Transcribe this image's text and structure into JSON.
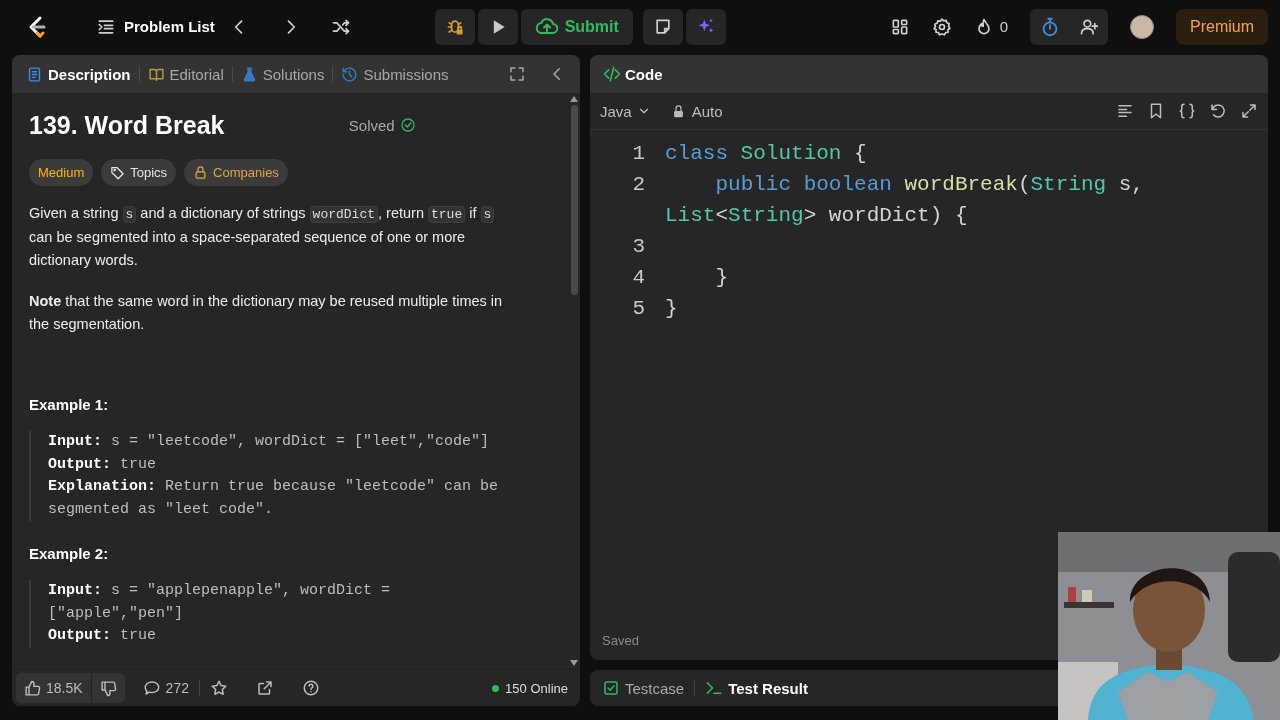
{
  "topbar": {
    "nav_label": "Problem List",
    "submit_label": "Submit",
    "streak_count": "0",
    "premium_label": "Premium"
  },
  "description_panel": {
    "tabs": [
      {
        "label": "Description",
        "kind": "description",
        "selected": true
      },
      {
        "label": "Editorial",
        "kind": "editorial",
        "selected": false
      },
      {
        "label": "Solutions",
        "kind": "solutions",
        "selected": false
      },
      {
        "label": "Submissions",
        "kind": "submissions",
        "selected": false
      }
    ],
    "title": "139. Word Break",
    "status": "Solved",
    "tags": [
      {
        "label": "Medium",
        "kind": "difficulty"
      },
      {
        "label": "Topics",
        "kind": "topics"
      },
      {
        "label": "Companies",
        "kind": "companies"
      }
    ],
    "paragraphs": [
      {
        "segments": [
          {
            "kind": "text",
            "text": "Given a string "
          },
          {
            "kind": "code",
            "text": "s"
          },
          {
            "kind": "text",
            "text": " and a dictionary of strings "
          },
          {
            "kind": "code",
            "text": "wordDict"
          },
          {
            "kind": "text",
            "text": ", return "
          },
          {
            "kind": "code",
            "text": "true"
          },
          {
            "kind": "text",
            "text": " if "
          },
          {
            "kind": "code",
            "text": "s"
          },
          {
            "kind": "text",
            "text": " can be segmented into a space-separated sequence of one or more dictionary words."
          }
        ]
      },
      {
        "segments": [
          {
            "kind": "text",
            "text": "**Note** that the same word in the dictionary may be reused multiple times in the segmentation."
          }
        ]
      }
    ],
    "examples": [
      {
        "title": "Example 1:",
        "lines": [
          {
            "label": "Input:",
            "value": "s = \"leetcode\", wordDict = [\"leet\",\"code\"]"
          },
          {
            "label": "Output:",
            "value": "true"
          },
          {
            "label": "Explanation:",
            "value": "Return true because \"leetcode\" can be segmented as \"leet code\"."
          }
        ]
      },
      {
        "title": "Example 2:",
        "lines": [
          {
            "label": "Input:",
            "value": "s = \"applepenapple\", wordDict = [\"apple\",\"pen\"]"
          },
          {
            "label": "Output:",
            "value": "true"
          }
        ]
      }
    ],
    "footer": {
      "likes": "18.5K",
      "comments": "272",
      "online": "150 Online"
    }
  },
  "code_panel": {
    "title": "Code",
    "language": "Java",
    "mode": "Auto",
    "lines": [
      {
        "number": "1",
        "tokens": [
          {
            "kind": "keyword",
            "text": "class"
          },
          {
            "kind": "type",
            "text": " Solution"
          },
          {
            "kind": "plain",
            "text": " {"
          }
        ]
      },
      {
        "number": "2",
        "tokens": [
          {
            "kind": "keyword",
            "text": "    public"
          },
          {
            "kind": "keyword",
            "text": " boolean"
          },
          {
            "kind": "function",
            "text": " wordBreak"
          },
          {
            "kind": "plain",
            "text": "("
          },
          {
            "kind": "type",
            "text": "String"
          },
          {
            "kind": "plain",
            "text": " s, "
          },
          {
            "kind": "type",
            "text": "List"
          },
          {
            "kind": "plain",
            "text": "<"
          },
          {
            "kind": "type",
            "text": "String"
          },
          {
            "kind": "plain",
            "text": "> wordDict) {"
          }
        ]
      },
      {
        "number": "3"
      },
      {
        "number": "4",
        "tokens": [
          {
            "kind": "plain",
            "text": "    }"
          }
        ]
      },
      {
        "number": "5",
        "tokens": [
          {
            "kind": "plain",
            "text": "}"
          }
        ]
      }
    ],
    "status": "Saved"
  },
  "test_panel": {
    "tabs": [
      {
        "label": "Testcase",
        "kind": "testcase",
        "selected": false
      },
      {
        "label": "Test Result",
        "kind": "result",
        "selected": true
      }
    ]
  }
}
